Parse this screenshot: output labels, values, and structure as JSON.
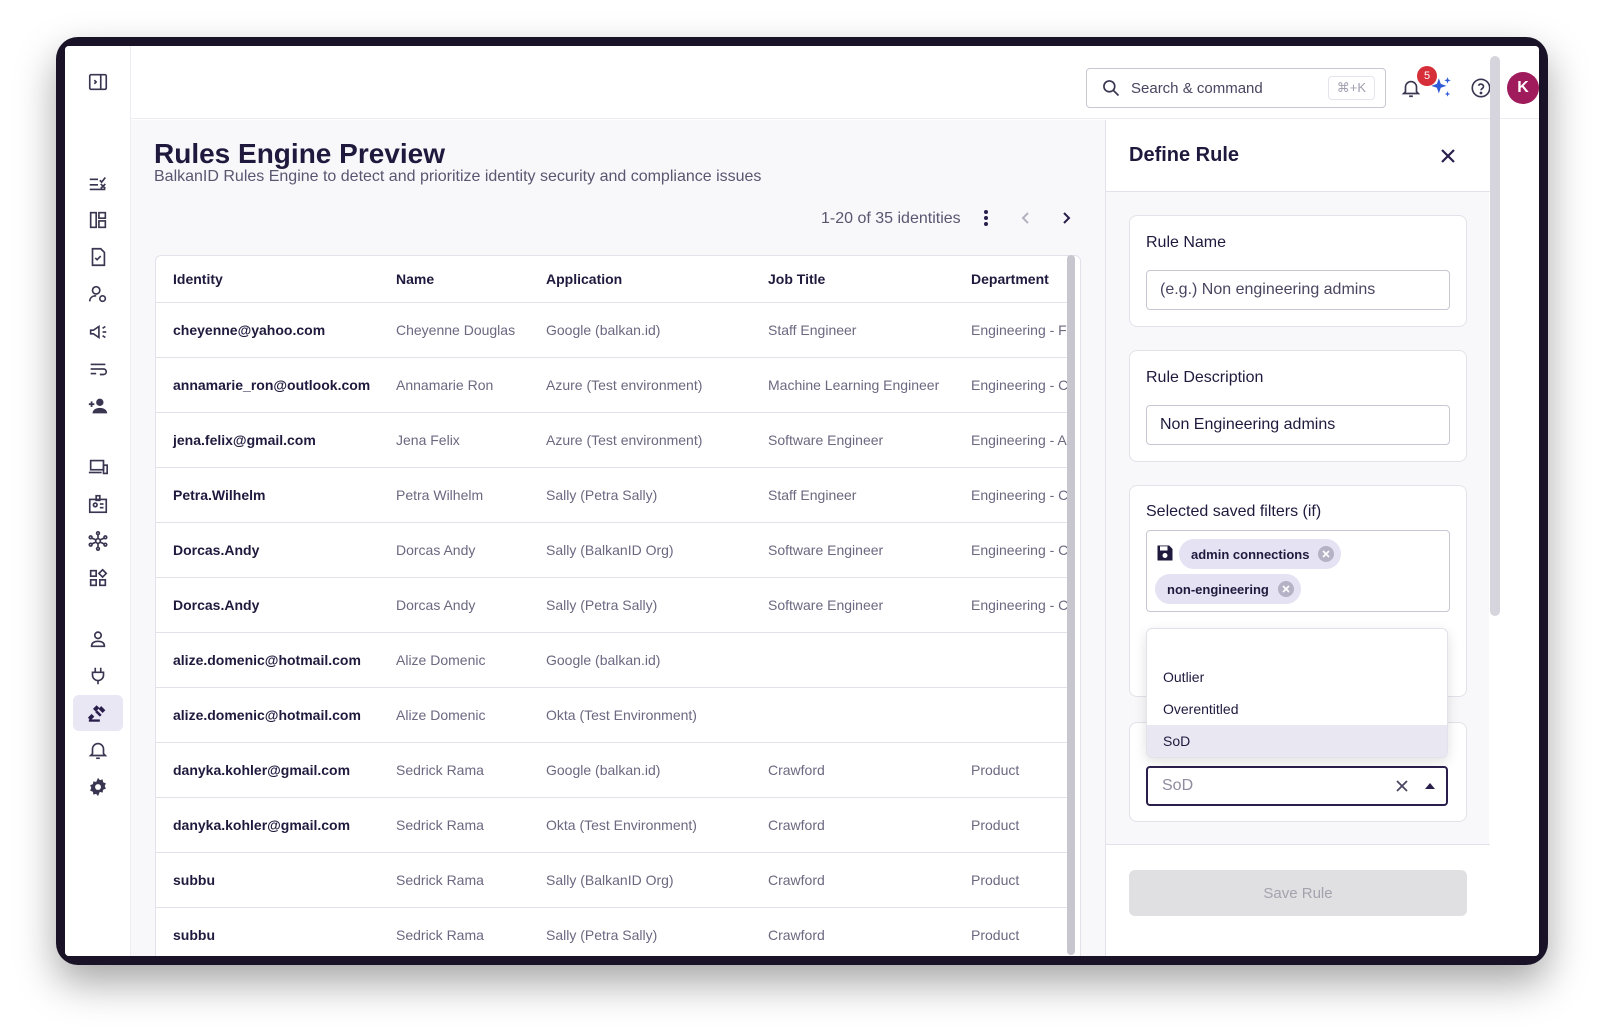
{
  "header": {
    "search_placeholder": "Search & command",
    "search_shortcut": "⌘+K",
    "notification_count": "5",
    "avatar_initial": "K"
  },
  "sidebar": {
    "items": [
      {
        "name": "sidebar-toggle-icon"
      },
      {
        "name": "tasks-icon"
      },
      {
        "name": "dashboard-icon"
      },
      {
        "name": "review-icon"
      },
      {
        "name": "user-settings-icon"
      },
      {
        "name": "campaign-icon"
      },
      {
        "name": "list-icon"
      },
      {
        "name": "add-user-icon"
      },
      {
        "name": "devices-icon"
      },
      {
        "name": "id-card-icon"
      },
      {
        "name": "network-icon"
      },
      {
        "name": "apps-icon"
      },
      {
        "name": "person-icon"
      },
      {
        "name": "plug-icon"
      },
      {
        "name": "gavel-icon"
      },
      {
        "name": "bell-icon"
      },
      {
        "name": "gear-icon"
      }
    ],
    "active": "gavel-icon"
  },
  "main": {
    "title": "Rules Engine Preview",
    "subtitle": "BalkanID Rules Engine to detect and prioritize identity security and compliance issues",
    "pager_text": "1-20 of 35 identities",
    "columns": [
      "Identity",
      "Name",
      "Application",
      "Job Title",
      "Department"
    ],
    "rows": [
      [
        "cheyenne@yahoo.com",
        "Cheyenne Douglas",
        "Google (balkan.id)",
        "Staff Engineer",
        "Engineering - F"
      ],
      [
        "annamarie_ron@outlook.com",
        "Annamarie Ron",
        "Azure (Test environment)",
        "Machine Learning Engineer",
        "Engineering - C"
      ],
      [
        "jena.felix@gmail.com",
        "Jena Felix",
        "Azure (Test environment)",
        "Software Engineer",
        "Engineering - A"
      ],
      [
        "Petra.Wilhelm",
        "Petra Wilhelm",
        "Sally (Petra Sally)",
        "Staff Engineer",
        "Engineering - C"
      ],
      [
        "Dorcas.Andy",
        "Dorcas Andy",
        "Sally (BalkanID Org)",
        "Software Engineer",
        "Engineering - C"
      ],
      [
        "Dorcas.Andy",
        "Dorcas Andy",
        "Sally (Petra Sally)",
        "Software Engineer",
        "Engineering - C"
      ],
      [
        "alize.domenic@hotmail.com",
        "Alize Domenic",
        "Google (balkan.id)",
        "",
        ""
      ],
      [
        "alize.domenic@hotmail.com",
        "Alize Domenic",
        "Okta (Test Environment)",
        "",
        ""
      ],
      [
        "danyka.kohler@gmail.com",
        "Sedrick Rama",
        "Google (balkan.id)",
        "Crawford",
        "Product"
      ],
      [
        "danyka.kohler@gmail.com",
        "Sedrick Rama",
        "Okta (Test Environment)",
        "Crawford",
        "Product"
      ],
      [
        "subbu",
        "Sedrick Rama",
        "Sally (BalkanID Org)",
        "Crawford",
        "Product"
      ],
      [
        "subbu",
        "Sedrick Rama",
        "Sally (Petra Sally)",
        "Crawford",
        "Product"
      ]
    ]
  },
  "panel": {
    "title": "Define Rule",
    "rule_name_label": "Rule Name",
    "rule_name_placeholder": "(e.g.) Non engineering admins",
    "rule_desc_label": "Rule Description",
    "rule_desc_value": "Non Engineering admins",
    "filters_label": "Selected saved filters (if)",
    "chips": [
      "admin connections",
      "non-engineering"
    ],
    "dropdown_options": [
      "Outlier",
      "Overentitled",
      "SoD"
    ],
    "selected_option": "SoD",
    "combo_value": "SoD",
    "save_label": "Save Rule"
  },
  "colors": {
    "accent": "#2a1f4c",
    "avatar": "#a01b5c",
    "badge": "#d62f3a",
    "spark": "#2f5bd8"
  }
}
